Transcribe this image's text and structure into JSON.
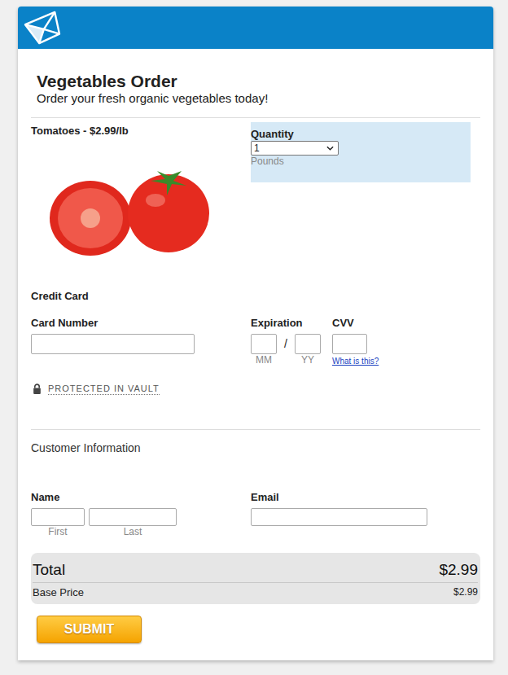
{
  "form": {
    "title": "Vegetables Order",
    "subtitle": "Order your fresh organic vegetables today!"
  },
  "product": {
    "name": "Tomatoes - $2.99/lb",
    "quantity": {
      "label": "Quantity",
      "value": "1",
      "unit": "Pounds"
    }
  },
  "credit_card": {
    "title": "Credit Card",
    "card_number": {
      "label": "Card Number",
      "value": ""
    },
    "expiration": {
      "label": "Expiration",
      "month_hint": "MM",
      "separator": "/",
      "year_hint": "YY"
    },
    "cvv": {
      "label": "CVV",
      "help": "What is this?"
    },
    "vault": "PROTECTED IN VAULT"
  },
  "customer": {
    "title": "Customer Information",
    "name": {
      "label": "Name",
      "first_hint": "First",
      "last_hint": "Last"
    },
    "email": {
      "label": "Email",
      "value": ""
    }
  },
  "summary": {
    "total_label": "Total",
    "total": "$2.99",
    "base_label": "Base Price",
    "base": "$2.99"
  },
  "submit": "SUBMIT"
}
